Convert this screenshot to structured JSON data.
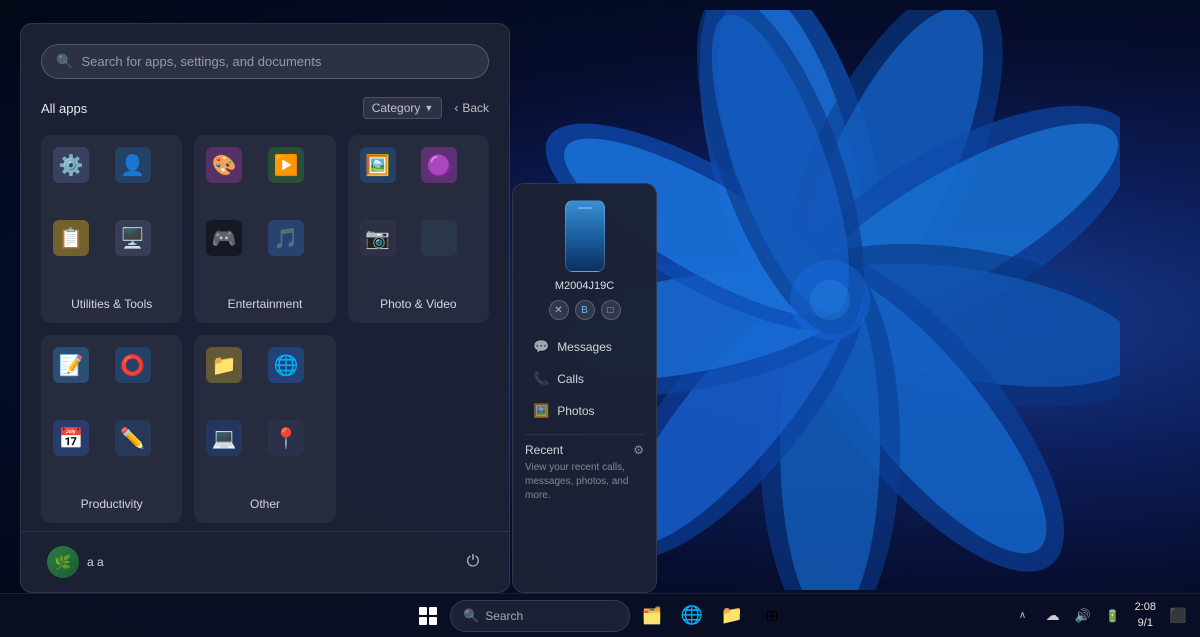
{
  "desktop": {
    "background": "Windows 11 blue swirl"
  },
  "search": {
    "placeholder": "Search for apps, settings, and documents"
  },
  "start_menu": {
    "all_apps_label": "All apps",
    "category_label": "Category",
    "back_label": "Back",
    "folders": [
      {
        "name": "Utilities & Tools",
        "icons": [
          "⚙️",
          "👤",
          "📋",
          "🖥️"
        ]
      },
      {
        "name": "Entertainment",
        "icons": [
          "🎨",
          "▶️",
          "🎮",
          "🎵"
        ]
      },
      {
        "name": "Photo & Video",
        "icons": [
          "🖼️",
          "🟣",
          "📷",
          ""
        ]
      },
      {
        "name": "Productivity",
        "icons": [
          "📝",
          "⭕",
          "📅",
          "✏️"
        ]
      },
      {
        "name": "Other",
        "icons": [
          "📁",
          "🌐",
          "💻",
          "📍"
        ]
      }
    ],
    "user": {
      "name": "a a",
      "avatar_emoji": "🌿"
    },
    "power_label": "⏻"
  },
  "phone_panel": {
    "device_name": "M2004J19C",
    "menu_items": [
      {
        "icon": "💬",
        "label": "Messages"
      },
      {
        "icon": "📞",
        "label": "Calls"
      },
      {
        "icon": "🖼️",
        "label": "Photos"
      }
    ],
    "recent": {
      "label": "Recent",
      "description": "View your recent calls, messages, photos, and more."
    }
  },
  "taskbar": {
    "search_label": "Search",
    "clock": {
      "time": "2:08",
      "date": "9/1"
    }
  }
}
